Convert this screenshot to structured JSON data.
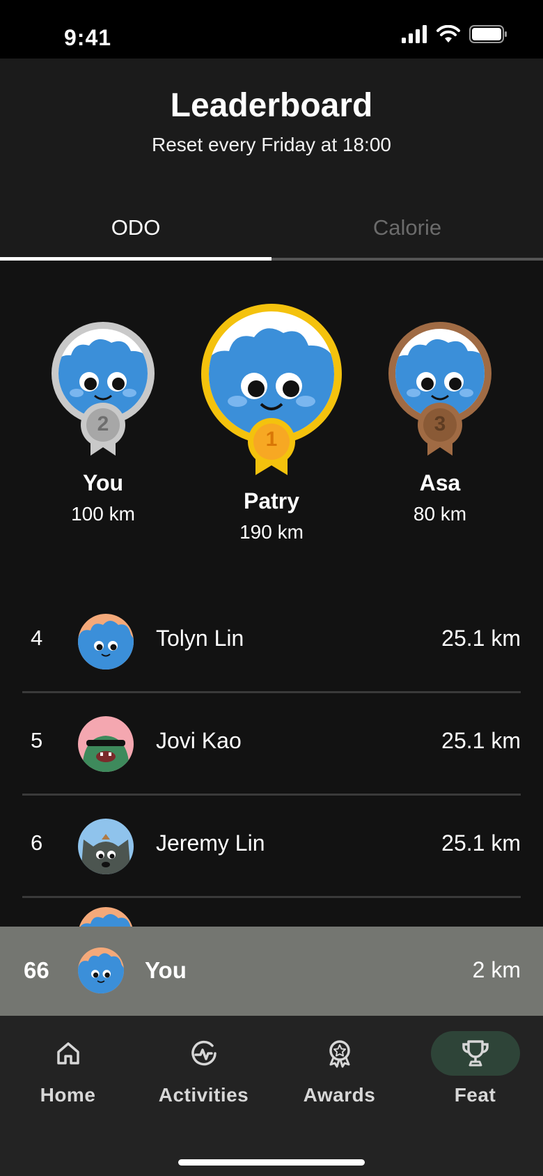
{
  "status_bar": {
    "time": "9:41"
  },
  "header": {
    "title": "Leaderboard",
    "subtitle": "Reset every Friday at 18:00"
  },
  "tabs": [
    {
      "label": "ODO",
      "active": true
    },
    {
      "label": "Calorie",
      "active": false
    }
  ],
  "podium": {
    "second": {
      "rank": "2",
      "name": "You",
      "value": "100 km",
      "medal_color": "#c9c9c9"
    },
    "first": {
      "rank": "1",
      "name": "Patry",
      "value": "190 km",
      "medal_color": "#f4c20d"
    },
    "third": {
      "rank": "3",
      "name": "Asa",
      "value": "80 km",
      "medal_color": "#a06b44"
    }
  },
  "leaderboard": [
    {
      "rank": "4",
      "name": "Tolyn Lin",
      "value": "25.1 km",
      "avatar": "blue-cloud-avatar"
    },
    {
      "rank": "5",
      "name": "Jovi Kao",
      "value": "25.1 km",
      "avatar": "green-monster-avatar"
    },
    {
      "rank": "6",
      "name": "Jeremy Lin",
      "value": "25.1 km",
      "avatar": "grey-wolf-avatar"
    }
  ],
  "my_rank": {
    "rank": "66",
    "name": "You",
    "value": "2 km"
  },
  "nav": [
    {
      "label": "Home",
      "icon": "home-icon",
      "active": false
    },
    {
      "label": "Activities",
      "icon": "activity-icon",
      "active": false
    },
    {
      "label": "Awards",
      "icon": "award-icon",
      "active": false
    },
    {
      "label": "Feat",
      "icon": "trophy-icon",
      "active": true
    }
  ],
  "colors": {
    "accent_active_nav": "#2e4438",
    "gold": "#f4c20d",
    "silver": "#c9c9c9",
    "bronze": "#a06b44",
    "avatar_blue": "#3b8fd9"
  }
}
